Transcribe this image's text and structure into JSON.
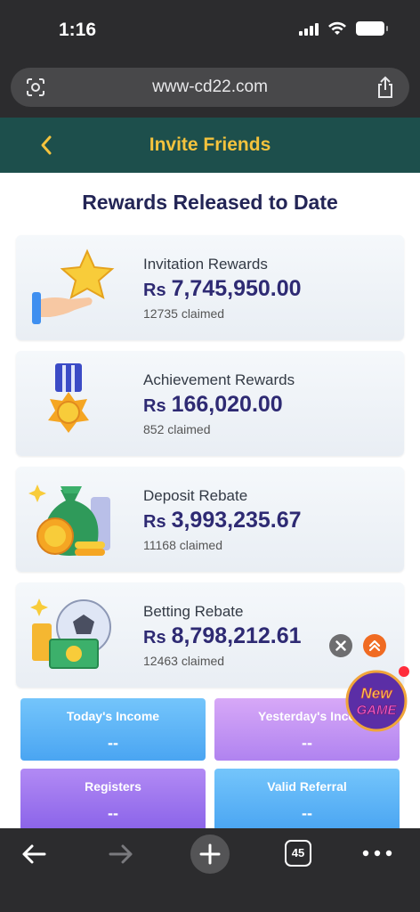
{
  "status_bar": {
    "time": "1:16"
  },
  "browser": {
    "url": "www-cd22.com",
    "tab_count": "45"
  },
  "header": {
    "title": "Invite Friends"
  },
  "main": {
    "section_title": "Rewards Released to Date",
    "currency_symbol": "Rs",
    "cards": [
      {
        "label": "Invitation Rewards",
        "amount": "7,745,950.00",
        "claimed": "12735 claimed",
        "icon": "star-hand-icon"
      },
      {
        "label": "Achievement Rewards",
        "amount": "166,020.00",
        "claimed": "852 claimed",
        "icon": "medal-icon"
      },
      {
        "label": "Deposit Rebate",
        "amount": "3,993,235.67",
        "claimed": "11168 claimed",
        "icon": "money-bag-icon"
      },
      {
        "label": "Betting Rebate",
        "amount": "8,798,212.61",
        "claimed": "12463 claimed",
        "icon": "soccer-cash-icon"
      }
    ],
    "tiles": [
      {
        "label": "Today's Income",
        "value": "--"
      },
      {
        "label": "Yesterday's Inco",
        "value": "--"
      },
      {
        "label": "Registers",
        "value": "--"
      },
      {
        "label": "Valid Referral",
        "value": "--"
      }
    ],
    "new_game_badge": {
      "line1": "New",
      "line2": "GAME"
    }
  },
  "colors": {
    "header_bg": "#1d4f4c",
    "header_title": "#f4c33d",
    "amount_text": "#2e2a73",
    "section_title": "#232556"
  }
}
